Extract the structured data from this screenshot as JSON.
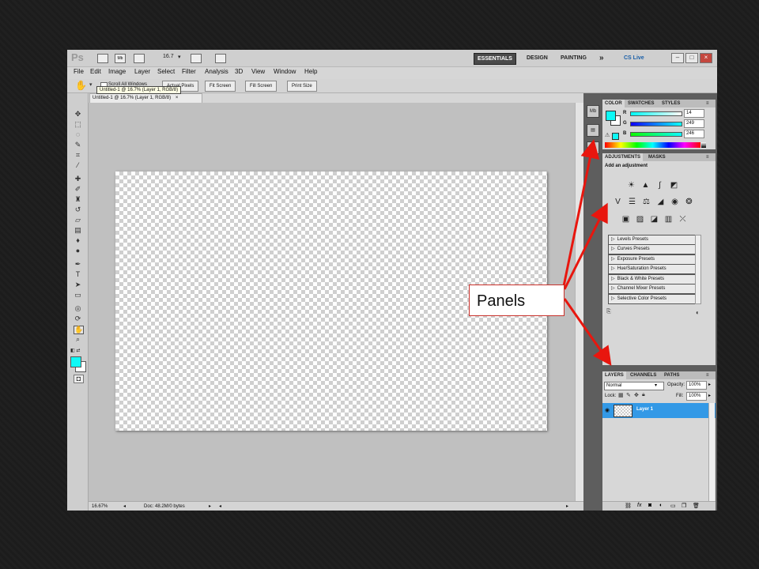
{
  "app": {
    "logo": "Ps",
    "zoom_select": "16.7",
    "workspaces": [
      "ESSENTIALS",
      "DESIGN",
      "PAINTING"
    ],
    "more_chevrons": "»",
    "cs_live": "CS Live",
    "window_buttons": [
      "–",
      "□",
      "×"
    ]
  },
  "menu": [
    "File",
    "Edit",
    "Image",
    "Layer",
    "Select",
    "Filter",
    "Analysis",
    "3D",
    "View",
    "Window",
    "Help"
  ],
  "options": {
    "scroll_all_windows": "Scroll All Windows",
    "buttons": [
      "Actual Pixels",
      "Fit Screen",
      "Fill Screen",
      "Print Size"
    ]
  },
  "tooltip": "Untitled-1 @ 16.7% (Layer 1, RGB/8)",
  "document": {
    "tab_title": "Untitled-1 @ 16.7% (Layer 1, RGB/8)",
    "tab_close": "×"
  },
  "status": {
    "zoom": "16.67%",
    "doc_info": "Doc: 48.2M/0 bytes"
  },
  "colors": {
    "foreground": "#0ef9f6",
    "background": "#ffffff",
    "layer_selected": "#3399e6",
    "arrow": "#e8160e"
  },
  "color_panel": {
    "tabs": [
      "COLOR",
      "SWATCHES",
      "STYLES"
    ],
    "channels": [
      {
        "name": "R",
        "value": "14"
      },
      {
        "name": "G",
        "value": "249"
      },
      {
        "name": "B",
        "value": "246"
      }
    ]
  },
  "adjustments_panel": {
    "tabs": [
      "ADJUSTMENTS",
      "MASKS"
    ],
    "heading": "Add an adjustment",
    "presets": [
      "Levels Presets",
      "Curves Presets",
      "Exposure Presets",
      "Hue/Saturation Presets",
      "Black & White Presets",
      "Channel Mixer Presets",
      "Selective Color Presets"
    ]
  },
  "layers_panel": {
    "tabs": [
      "LAYERS",
      "CHANNELS",
      "PATHS"
    ],
    "blend_mode": "Normal",
    "opacity_label": "Opacity:",
    "opacity_value": "100%",
    "lock_label": "Lock:",
    "fill_label": "Fill:",
    "fill_value": "100%",
    "layers": [
      {
        "name": "Layer 1"
      }
    ]
  },
  "callout": "Panels"
}
